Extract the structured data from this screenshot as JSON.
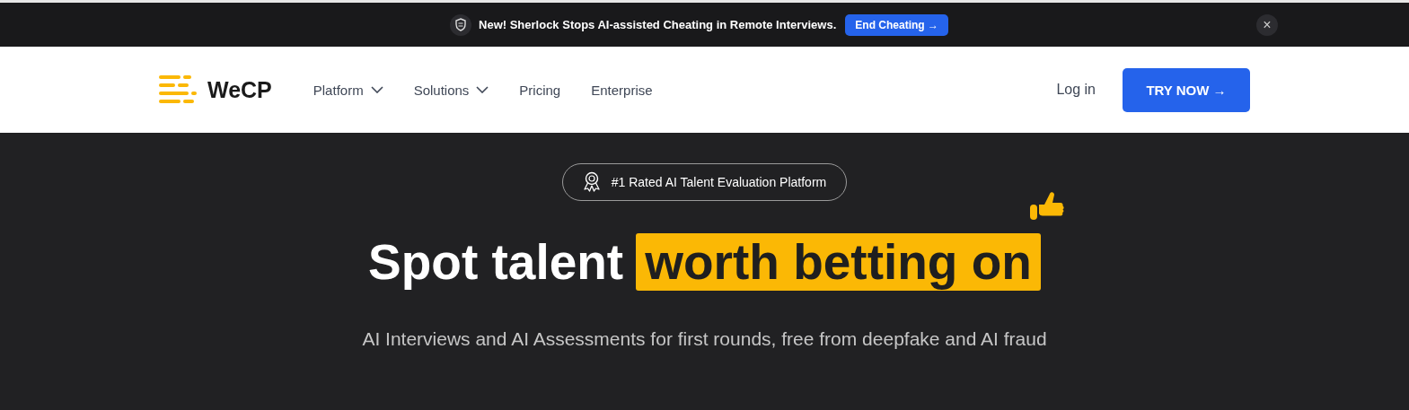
{
  "announcement": {
    "text": "New! Sherlock Stops AI-assisted Cheating in Remote Interviews.",
    "button": "End Cheating →",
    "close": "×"
  },
  "nav": {
    "logo": "WeCP",
    "items": [
      {
        "label": "Platform",
        "has_menu": true
      },
      {
        "label": "Solutions",
        "has_menu": true
      },
      {
        "label": "Pricing",
        "has_menu": false
      },
      {
        "label": "Enterprise",
        "has_menu": false
      }
    ],
    "login": "Log in",
    "cta": "TRY NOW →"
  },
  "hero": {
    "badge": "#1 Rated AI Talent Evaluation Platform",
    "headline": [
      {
        "text": "Spot talent",
        "highlighted": false
      },
      {
        "text": "worth betting on",
        "highlighted": true
      }
    ],
    "subtitle": "AI Interviews and AI Assessments for first rounds, free from deepfake and AI fraud"
  }
}
